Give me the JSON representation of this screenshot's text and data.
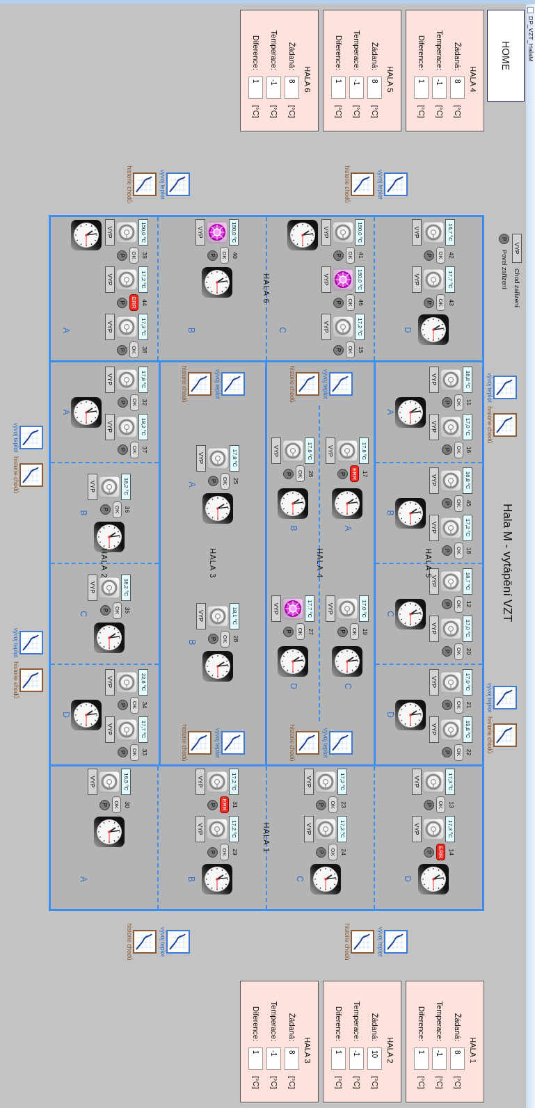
{
  "window": {
    "title": "DP_VZT_HalaM"
  },
  "home_button": "HOME",
  "title": "Hala M - vytápění VZT",
  "legend": [
    {
      "kind": "run",
      "symbol": "VYP",
      "label": "Chod zařízení"
    },
    {
      "kind": "command",
      "symbol": "P",
      "label": "Povel zařízení"
    }
  ],
  "setpoint_panels_left": [
    {
      "title": "HALA 4",
      "rows": [
        {
          "label": "Žádaná:",
          "value": "8",
          "unit": "[°C]"
        },
        {
          "label": "Temperace:",
          "value": "-1",
          "unit": "[°C]"
        },
        {
          "label": "Diference:",
          "value": "1",
          "unit": "[°C]"
        }
      ]
    },
    {
      "title": "HALA 5",
      "rows": [
        {
          "label": "Žádaná:",
          "value": "8",
          "unit": "[°C]"
        },
        {
          "label": "Temperace:",
          "value": "-1",
          "unit": "[°C]"
        },
        {
          "label": "Diference:",
          "value": "1",
          "unit": "[°C]"
        }
      ]
    },
    {
      "title": "HALA 6",
      "rows": [
        {
          "label": "Žádaná:",
          "value": "8",
          "unit": "[°C]"
        },
        {
          "label": "Temperace:",
          "value": "-1",
          "unit": "[°C]"
        },
        {
          "label": "Diference:",
          "value": "1",
          "unit": "[°C]"
        }
      ]
    }
  ],
  "chart_links": {
    "top": [
      [
        {
          "kind": "trend",
          "label": "vývoj teplot"
        },
        {
          "kind": "history",
          "label": "historie chodů"
        }
      ],
      [
        {
          "kind": "trend",
          "label": "vývoj teplot"
        },
        {
          "kind": "history",
          "label": "historie chodů"
        }
      ]
    ],
    "left": [
      [
        {
          "kind": "trend",
          "label": "vývoj teplot"
        },
        {
          "kind": "history",
          "label": "historie chodů"
        }
      ],
      [
        {
          "kind": "trend",
          "label": "vývoj teplot"
        },
        {
          "kind": "history",
          "label": "historie chodů"
        }
      ]
    ],
    "right": [
      [
        {
          "kind": "trend",
          "label": "vývoj teplot"
        },
        {
          "kind": "history",
          "label": "historie chodů"
        }
      ],
      [
        {
          "kind": "trend",
          "label": "vývoj teplot"
        },
        {
          "kind": "history",
          "label": "historie chodů"
        }
      ]
    ],
    "bottom": [
      [
        {
          "kind": "trend",
          "label": "vývoj teplot"
        },
        {
          "kind": "history",
          "label": "historie chodů"
        }
      ],
      [
        {
          "kind": "trend",
          "label": "vývoj teplot"
        },
        {
          "kind": "history",
          "label": "historie chodů"
        }
      ]
    ]
  },
  "halls": [
    {
      "title": "HALA 6",
      "kind": "rows",
      "zones": [
        {
          "label": "D",
          "units": [
            {
              "number": "42",
              "temperature": "16,7 °C",
              "running": false,
              "state": "VYP",
              "status": "OK",
              "alarm": false,
              "command": "P"
            },
            {
              "number": "43",
              "temperature": "17,7 °C",
              "running": false,
              "state": "VYP",
              "status": "OK",
              "alarm": false,
              "command": "P"
            }
          ]
        },
        {
          "label": "C",
          "units": [
            {
              "number": "41",
              "temperature": "150,0 °C",
              "running": false,
              "state": "VYP",
              "status": "OK",
              "alarm": false,
              "command": "P"
            },
            {
              "number": "46",
              "temperature": "150,0 °C",
              "running": true,
              "state": "VYP",
              "status": "OK",
              "alarm": false,
              "command": "P"
            },
            {
              "number": "15",
              "temperature": "17,2 °C",
              "running": false,
              "state": "VYP",
              "status": "OK",
              "alarm": false,
              "command": "P"
            }
          ]
        },
        {
          "label": "B",
          "units": [
            {
              "number": "40",
              "temperature": "150,0 °C",
              "running": true,
              "state": "VYP",
              "status": "OK",
              "alarm": false,
              "command": "P"
            }
          ]
        },
        {
          "label": "A",
          "units": [
            {
              "number": "39",
              "temperature": "150,0 °C",
              "running": false,
              "state": "VYP",
              "status": "OK",
              "alarm": false,
              "command": "P"
            },
            {
              "number": "44",
              "temperature": "17,2 °C",
              "running": false,
              "state": "VYP",
              "status": "ERR",
              "alarm": true,
              "command": "P"
            },
            {
              "number": "38",
              "temperature": "17,3 °C",
              "running": false,
              "state": "VYP",
              "status": "OK",
              "alarm": false,
              "command": "P"
            }
          ]
        }
      ]
    },
    {
      "title": "HALA 5",
      "kind": "columns",
      "zones": [
        {
          "label": "A",
          "units": [
            {
              "number": "11",
              "temperature": "16,8 °C",
              "running": false,
              "state": "VYP",
              "status": "OK",
              "alarm": false,
              "command": "P"
            },
            {
              "number": "16",
              "temperature": "17,0 °C",
              "running": false,
              "state": "VYP",
              "status": "OK",
              "alarm": false,
              "command": "P"
            }
          ]
        },
        {
          "label": "B",
          "units": [
            {
              "number": "45",
              "temperature": "16,8 °C",
              "running": false,
              "state": "VYP",
              "status": "OK",
              "alarm": false,
              "command": "P"
            },
            {
              "number": "18",
              "temperature": "17,2 °C",
              "running": false,
              "state": "VYP",
              "status": "OK",
              "alarm": false,
              "command": "P"
            }
          ]
        },
        {
          "label": "C",
          "units": [
            {
              "number": "12",
              "temperature": "16,7 °C",
              "running": false,
              "state": "VYP",
              "status": "OK",
              "alarm": false,
              "command": "P"
            },
            {
              "number": "20",
              "temperature": "17,0 °C",
              "running": false,
              "state": "VYP",
              "status": "OK",
              "alarm": false,
              "command": "P"
            }
          ]
        },
        {
          "label": "D",
          "units": [
            {
              "number": "21",
              "temperature": "17,0 °C",
              "running": false,
              "state": "VYP",
              "status": "OK",
              "alarm": false,
              "command": "P"
            },
            {
              "number": "22",
              "temperature": "19,8 °C",
              "running": false,
              "state": "VYP",
              "status": "OK",
              "alarm": false,
              "command": "P"
            }
          ]
        }
      ]
    },
    {
      "title": "HALA 4",
      "kind": "quad",
      "links": [
        [
          {
            "kind": "trend",
            "label": "vývoj teplot"
          },
          {
            "kind": "history",
            "label": "historie chodů"
          }
        ],
        [
          {
            "kind": "trend",
            "label": "vývoj teplot"
          },
          {
            "kind": "history",
            "label": "historie chodů"
          }
        ]
      ],
      "zones": [
        {
          "label": "A",
          "units": [
            {
              "number": "17",
              "temperature": "17,6 °C",
              "running": false,
              "state": "VYP",
              "status": "ERR",
              "alarm": true,
              "command": "P"
            }
          ]
        },
        {
          "label": "B",
          "units": [
            {
              "number": "26",
              "temperature": "17,6 °C",
              "running": false,
              "state": "VYP",
              "status": "OK",
              "alarm": false,
              "command": "P"
            }
          ]
        },
        {
          "label": "C",
          "units": [
            {
              "number": "19",
              "temperature": "17,0 °C",
              "running": false,
              "state": "VYP",
              "status": "OK",
              "alarm": false,
              "command": "P"
            }
          ]
        },
        {
          "label": "D",
          "units": [
            {
              "number": "27",
              "temperature": "17,7 °C",
              "running": true,
              "state": "VYP",
              "status": "OK",
              "alarm": false,
              "command": "P"
            }
          ]
        }
      ]
    },
    {
      "title": "HALA 3",
      "kind": "pair",
      "links": [
        [
          {
            "kind": "trend",
            "label": "vývoj teplot"
          },
          {
            "kind": "history",
            "label": "historie chodů"
          }
        ],
        [
          {
            "kind": "trend",
            "label": "vývoj teplot"
          },
          {
            "kind": "history",
            "label": "historie chodů"
          }
        ]
      ],
      "zones": [
        {
          "label": "A",
          "units": [
            {
              "number": "25",
              "temperature": "17,8 °C",
              "running": false,
              "state": "VYP",
              "status": "OK",
              "alarm": false,
              "command": "P"
            }
          ]
        },
        {
          "label": "B",
          "units": [
            {
              "number": "28",
              "temperature": "18,1 °C",
              "running": false,
              "state": "VYP",
              "status": "OK",
              "alarm": false,
              "command": "P"
            }
          ]
        }
      ]
    },
    {
      "title": "HALA 2",
      "kind": "columns",
      "zones": [
        {
          "label": "A",
          "units": [
            {
              "number": "32",
              "temperature": "17,8 °C",
              "running": false,
              "state": "VYP",
              "status": "OK",
              "alarm": false,
              "command": "P"
            },
            {
              "number": "37",
              "temperature": "18,2 °C",
              "running": false,
              "state": "VYP",
              "status": "OK",
              "alarm": false,
              "command": "P"
            }
          ]
        },
        {
          "label": "B",
          "units": [
            {
              "number": "36",
              "temperature": "18,2 °C",
              "running": false,
              "state": "VYP",
              "status": "OK",
              "alarm": false,
              "command": "P"
            }
          ]
        },
        {
          "label": "C",
          "units": [
            {
              "number": "35",
              "temperature": "18,2 °C",
              "running": false,
              "state": "VYP",
              "status": "OK",
              "alarm": false,
              "command": "P"
            }
          ]
        },
        {
          "label": "D",
          "units": [
            {
              "number": "34",
              "temperature": "22,6 °C",
              "running": false,
              "state": "VYP",
              "status": "OK",
              "alarm": false,
              "command": "P"
            },
            {
              "number": "33",
              "temperature": "17,7 °C",
              "running": false,
              "state": "VYP",
              "status": "OK",
              "alarm": false,
              "command": "P"
            }
          ]
        }
      ]
    },
    {
      "title": "HALA 1",
      "kind": "rows",
      "zones": [
        {
          "label": "D",
          "units": [
            {
              "number": "13",
              "temperature": "17,3 °C",
              "running": false,
              "state": "VYP",
              "status": "OK",
              "alarm": false,
              "command": "P"
            },
            {
              "number": "14",
              "temperature": "17,3 °C",
              "running": false,
              "state": "VYP",
              "status": "ERR",
              "alarm": true,
              "command": "P"
            }
          ]
        },
        {
          "label": "C",
          "units": [
            {
              "number": "23",
              "temperature": "17,2 °C",
              "running": false,
              "state": "VYP",
              "status": "OK",
              "alarm": false,
              "command": "P"
            },
            {
              "number": "24",
              "temperature": "17,2 °C",
              "running": false,
              "state": "VYP",
              "status": "OK",
              "alarm": false,
              "command": "P"
            }
          ]
        },
        {
          "label": "B",
          "units": [
            {
              "number": "31",
              "temperature": "17,2 °C",
              "running": false,
              "state": "VYP",
              "status": "ERR",
              "alarm": true,
              "command": "P"
            },
            {
              "number": "29",
              "temperature": "17,2 °C",
              "running": false,
              "state": "VYP",
              "status": "OK",
              "alarm": false,
              "command": "P"
            }
          ]
        },
        {
          "label": "A",
          "units": [
            {
              "number": "30",
              "temperature": "16,5 °C",
              "running": false,
              "state": "VYP",
              "status": "OK",
              "alarm": false,
              "command": "P"
            }
          ]
        }
      ]
    }
  ],
  "setpoint_panels_right": [
    {
      "title": "HALA 1",
      "rows": [
        {
          "label": "Žádaná:",
          "value": "8",
          "unit": "[°C]"
        },
        {
          "label": "Temperace:",
          "value": "-1",
          "unit": "[°C]"
        },
        {
          "label": "Diference:",
          "value": "1",
          "unit": "[°C]"
        }
      ]
    },
    {
      "title": "HALA 2",
      "rows": [
        {
          "label": "Žádaná:",
          "value": "10",
          "unit": "[°C]"
        },
        {
          "label": "Temperace:",
          "value": "-1",
          "unit": "[°C]"
        },
        {
          "label": "Diference:",
          "value": "1",
          "unit": "[°C]"
        }
      ]
    },
    {
      "title": "HALA 3",
      "rows": [
        {
          "label": "Žádaná:",
          "value": "8",
          "unit": "[°C]"
        },
        {
          "label": "Temperace:",
          "value": "-1",
          "unit": "[°C]"
        },
        {
          "label": "Diference:",
          "value": "1",
          "unit": "[°C]"
        }
      ]
    }
  ]
}
